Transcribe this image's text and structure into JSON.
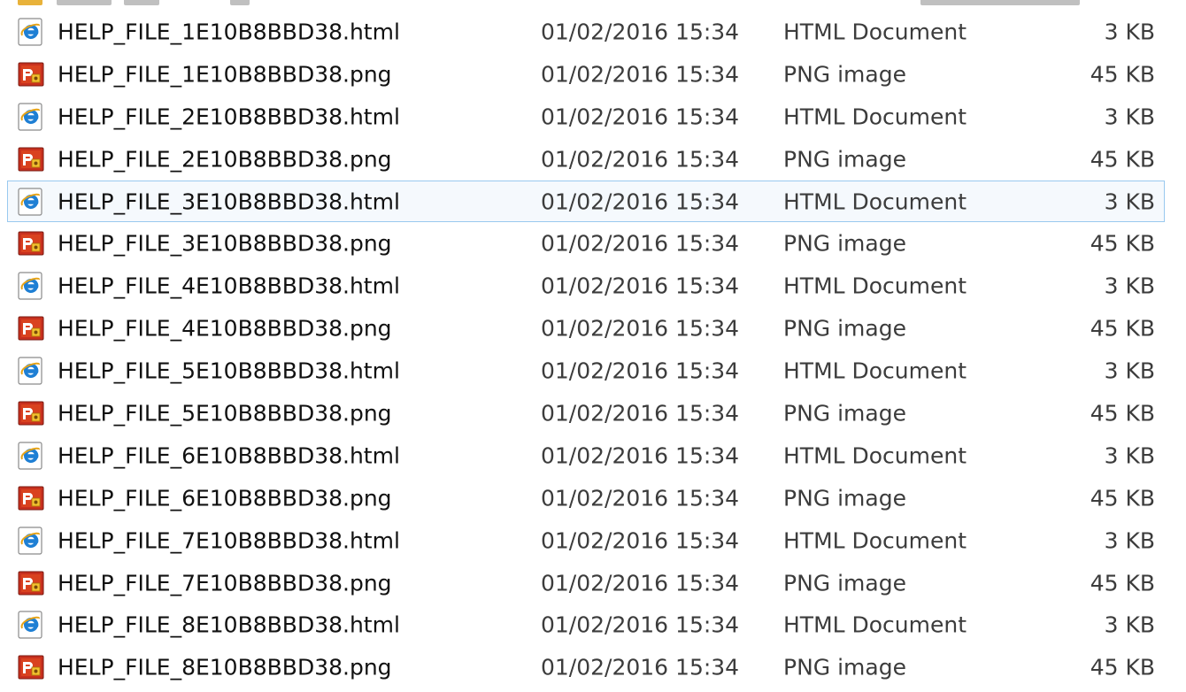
{
  "files": [
    {
      "name": "HELP_FILE_1E10B8BBD38.html",
      "date": "01/02/2016 15:34",
      "type": "HTML Document",
      "size": "3 KB",
      "icon": "ie-html-icon"
    },
    {
      "name": "HELP_FILE_1E10B8BBD38.png",
      "date": "01/02/2016 15:34",
      "type": "PNG image",
      "size": "45 KB",
      "icon": "png-image-icon"
    },
    {
      "name": "HELP_FILE_2E10B8BBD38.html",
      "date": "01/02/2016 15:34",
      "type": "HTML Document",
      "size": "3 KB",
      "icon": "ie-html-icon"
    },
    {
      "name": "HELP_FILE_2E10B8BBD38.png",
      "date": "01/02/2016 15:34",
      "type": "PNG image",
      "size": "45 KB",
      "icon": "png-image-icon"
    },
    {
      "name": "HELP_FILE_3E10B8BBD38.html",
      "date": "01/02/2016 15:34",
      "type": "HTML Document",
      "size": "3 KB",
      "icon": "ie-html-icon",
      "selected": true
    },
    {
      "name": "HELP_FILE_3E10B8BBD38.png",
      "date": "01/02/2016 15:34",
      "type": "PNG image",
      "size": "45 KB",
      "icon": "png-image-icon"
    },
    {
      "name": "HELP_FILE_4E10B8BBD38.html",
      "date": "01/02/2016 15:34",
      "type": "HTML Document",
      "size": "3 KB",
      "icon": "ie-html-icon"
    },
    {
      "name": "HELP_FILE_4E10B8BBD38.png",
      "date": "01/02/2016 15:34",
      "type": "PNG image",
      "size": "45 KB",
      "icon": "png-image-icon"
    },
    {
      "name": "HELP_FILE_5E10B8BBD38.html",
      "date": "01/02/2016 15:34",
      "type": "HTML Document",
      "size": "3 KB",
      "icon": "ie-html-icon"
    },
    {
      "name": "HELP_FILE_5E10B8BBD38.png",
      "date": "01/02/2016 15:34",
      "type": "PNG image",
      "size": "45 KB",
      "icon": "png-image-icon"
    },
    {
      "name": "HELP_FILE_6E10B8BBD38.html",
      "date": "01/02/2016 15:34",
      "type": "HTML Document",
      "size": "3 KB",
      "icon": "ie-html-icon"
    },
    {
      "name": "HELP_FILE_6E10B8BBD38.png",
      "date": "01/02/2016 15:34",
      "type": "PNG image",
      "size": "45 KB",
      "icon": "png-image-icon"
    },
    {
      "name": "HELP_FILE_7E10B8BBD38.html",
      "date": "01/02/2016 15:34",
      "type": "HTML Document",
      "size": "3 KB",
      "icon": "ie-html-icon"
    },
    {
      "name": "HELP_FILE_7E10B8BBD38.png",
      "date": "01/02/2016 15:34",
      "type": "PNG image",
      "size": "45 KB",
      "icon": "png-image-icon"
    },
    {
      "name": "HELP_FILE_8E10B8BBD38.html",
      "date": "01/02/2016 15:34",
      "type": "HTML Document",
      "size": "3 KB",
      "icon": "ie-html-icon"
    },
    {
      "name": "HELP_FILE_8E10B8BBD38.png",
      "date": "01/02/2016 15:34",
      "type": "PNG image",
      "size": "45 KB",
      "icon": "png-image-icon"
    }
  ],
  "colors": {
    "selection_border": "#99c9ef",
    "selection_fill": "#f5f9fd",
    "ie_blue": "#1e7fd4",
    "png_red": "#c8301e",
    "png_gold": "#f2c12e"
  }
}
